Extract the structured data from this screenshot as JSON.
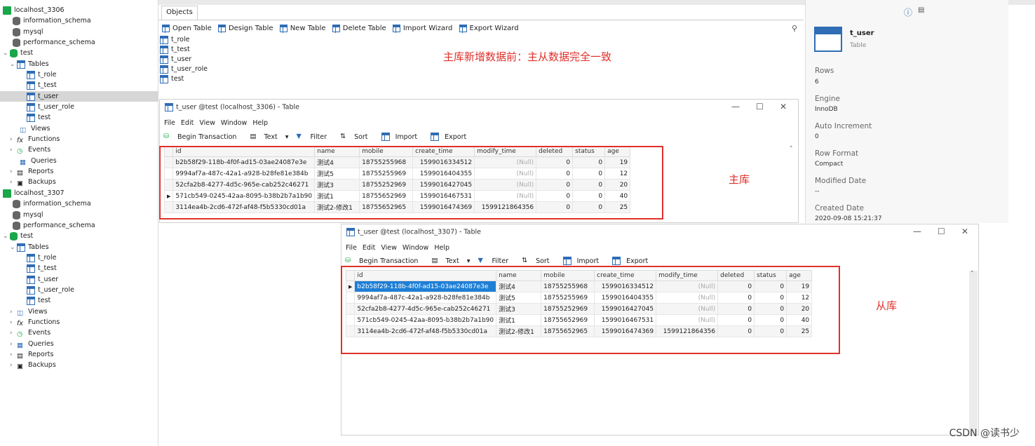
{
  "sidebar": {
    "conn1": "localhost_3306",
    "db1": [
      "information_schema",
      "mysql",
      "performance_schema"
    ],
    "test1": "test",
    "tables1": "Tables",
    "tbls1": [
      "t_role",
      "t_test",
      "t_user",
      "t_user_role",
      "test"
    ],
    "nodes1": [
      "Views",
      "Functions",
      "Events",
      "Queries",
      "Reports",
      "Backups"
    ],
    "conn2": "localhost_3307",
    "db2": [
      "information_schema",
      "mysql",
      "performance_schema"
    ],
    "test2": "test",
    "tables2": "Tables",
    "tbls2": [
      "t_role",
      "t_test",
      "t_user",
      "t_user_role",
      "test"
    ],
    "nodes2": [
      "Views",
      "Functions",
      "Events",
      "Queries",
      "Reports",
      "Backups"
    ]
  },
  "objects_tab": "Objects",
  "toolbar": [
    "Open Table",
    "Design Table",
    "New Table",
    "Delete Table",
    "Import Wizard",
    "Export Wizard"
  ],
  "objects": [
    "t_role",
    "t_test",
    "t_user",
    "t_user_role",
    "test"
  ],
  "annotations": {
    "top": "主库新增数据前：主从数据完全一致",
    "master": "主库",
    "slave": "从库"
  },
  "info": {
    "name": "t_user",
    "type": "Table",
    "rows_label": "Rows",
    "rows": "6",
    "engine_label": "Engine",
    "engine": "InnoDB",
    "ai_label": "Auto Increment",
    "ai": "0",
    "rf_label": "Row Format",
    "rf": "Compact",
    "md_label": "Modified Date",
    "md": "--",
    "cd_label": "Created Date",
    "cd": "2020-09-08 15:21:37"
  },
  "win1": {
    "title": "t_user @test (localhost_3306) - Table",
    "menu": [
      "File",
      "Edit",
      "View",
      "Window",
      "Help"
    ],
    "tools": [
      "Begin Transaction",
      "Text",
      "Filter",
      "Sort",
      "Import",
      "Export"
    ]
  },
  "win2": {
    "title": "t_user @test (localhost_3307) - Table",
    "menu": [
      "File",
      "Edit",
      "View",
      "Window",
      "Help"
    ],
    "tools": [
      "Begin Transaction",
      "Text",
      "Filter",
      "Sort",
      "Import",
      "Export"
    ]
  },
  "columns": [
    "id",
    "name",
    "mobile",
    "create_time",
    "modify_time",
    "deleted",
    "status",
    "age"
  ],
  "rows1": [
    [
      "b2b58f29-118b-4f0f-ad15-03ae24087e3e",
      "测试4",
      "18755255968",
      "1599016334512",
      "(Null)",
      "0",
      "0",
      "19"
    ],
    [
      "9994af7a-487c-42a1-a928-b28fe81e384b",
      "测试5",
      "18755255969",
      "1599016404355",
      "(Null)",
      "0",
      "0",
      "12"
    ],
    [
      "52cfa2b8-4277-4d5c-965e-cab252c46271",
      "测试3",
      "18755252969",
      "1599016427045",
      "(Null)",
      "0",
      "0",
      "20"
    ],
    [
      "571cb549-0245-42aa-8095-b38b2b7a1b90",
      "测试1",
      "18755652969",
      "1599016467531",
      "(Null)",
      "0",
      "0",
      "40"
    ],
    [
      "3114ea4b-2cd6-472f-af48-f5b5330cd01a",
      "测试2-修改1",
      "18755652965",
      "1599016474369",
      "1599121864356",
      "0",
      "0",
      "25"
    ]
  ],
  "rows2": [
    [
      "b2b58f29-118b-4f0f-ad15-03ae24087e3e",
      "测试4",
      "18755255968",
      "1599016334512",
      "(Null)",
      "0",
      "0",
      "19"
    ],
    [
      "9994af7a-487c-42a1-a928-b28fe81e384b",
      "测试5",
      "18755255969",
      "1599016404355",
      "(Null)",
      "0",
      "0",
      "12"
    ],
    [
      "52cfa2b8-4277-4d5c-965e-cab252c46271",
      "测试3",
      "18755252969",
      "1599016427045",
      "(Null)",
      "0",
      "0",
      "20"
    ],
    [
      "571cb549-0245-42aa-8095-b38b2b7a1b90",
      "测试1",
      "18755652969",
      "1599016467531",
      "(Null)",
      "0",
      "0",
      "40"
    ],
    [
      "3114ea4b-2cd6-472f-af48-f5b5330cd01a",
      "测试2-修改1",
      "18755652965",
      "1599016474369",
      "1599121864356",
      "0",
      "0",
      "25"
    ]
  ],
  "watermark": "CSDN @读书少"
}
